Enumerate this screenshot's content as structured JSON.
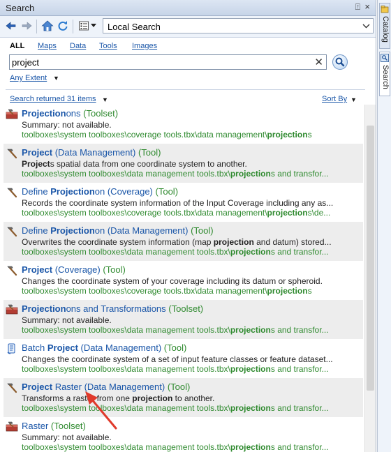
{
  "window": {
    "title": "Search",
    "pin_glyph": "⍐",
    "close_glyph": "×"
  },
  "toolbar": {
    "location": "Local Search"
  },
  "tabs": [
    "ALL",
    "Maps",
    "Data",
    "Tools",
    "Images"
  ],
  "search": {
    "value": "project"
  },
  "extent_label": "Any Extent",
  "results_count": "Search returned 31 items",
  "sort_label": "Sort By",
  "results": [
    {
      "icon": "toolset-icon",
      "name": [
        {
          "t": "Projection",
          "b": true
        },
        {
          "t": "ons",
          "b": false
        }
      ],
      "type": "(Toolset)",
      "desc": [
        {
          "t": "Summary: not available.",
          "b": false
        }
      ],
      "path": [
        {
          "t": "toolboxes\\system toolboxes\\coverage tools.tbx\\data management\\",
          "b": false
        },
        {
          "t": "projection",
          "b": true
        },
        {
          "t": "s",
          "b": false
        }
      ]
    },
    {
      "icon": "hammer-icon",
      "name": [
        {
          "t": "Project",
          "b": true
        },
        {
          "t": " (Data Management)",
          "b": false
        }
      ],
      "type": "(Tool)",
      "desc": [
        {
          "t": "Project",
          "b": true
        },
        {
          "t": "s spatial data from one coordinate system to another.",
          "b": false
        }
      ],
      "path": [
        {
          "t": "toolboxes\\system toolboxes\\data management tools.tbx\\",
          "b": false
        },
        {
          "t": "projection",
          "b": true
        },
        {
          "t": "s and transfor...",
          "b": false
        }
      ]
    },
    {
      "icon": "hammer-icon",
      "name": [
        {
          "t": "Define ",
          "b": false
        },
        {
          "t": "Projection",
          "b": true
        },
        {
          "t": "on (Coverage)",
          "b": false
        }
      ],
      "type": "(Tool)",
      "desc": [
        {
          "t": "Records the coordinate system information of the Input Coverage including any as...",
          "b": false
        }
      ],
      "path": [
        {
          "t": "toolboxes\\system toolboxes\\coverage tools.tbx\\data management\\",
          "b": false
        },
        {
          "t": "projection",
          "b": true
        },
        {
          "t": "s\\de...",
          "b": false
        }
      ]
    },
    {
      "icon": "hammer-icon",
      "name": [
        {
          "t": "Define ",
          "b": false
        },
        {
          "t": "Projection",
          "b": true
        },
        {
          "t": "on (Data Management)",
          "b": false
        }
      ],
      "type": "(Tool)",
      "desc": [
        {
          "t": "Overwrites the coordinate system information (map ",
          "b": false
        },
        {
          "t": "projection",
          "b": true
        },
        {
          "t": " and datum) stored...",
          "b": false
        }
      ],
      "path": [
        {
          "t": "toolboxes\\system toolboxes\\data management tools.tbx\\",
          "b": false
        },
        {
          "t": "projection",
          "b": true
        },
        {
          "t": "s and transfor...",
          "b": false
        }
      ]
    },
    {
      "icon": "hammer-icon",
      "name": [
        {
          "t": "Project",
          "b": true
        },
        {
          "t": " (Coverage)",
          "b": false
        }
      ],
      "type": "(Tool)",
      "desc": [
        {
          "t": "Changes the coordinate system of your coverage including its datum or spheroid.",
          "b": false
        }
      ],
      "path": [
        {
          "t": "toolboxes\\system toolboxes\\coverage tools.tbx\\data management\\",
          "b": false
        },
        {
          "t": "projection",
          "b": true
        },
        {
          "t": "s",
          "b": false
        }
      ]
    },
    {
      "icon": "toolset-icon",
      "name": [
        {
          "t": "Projection",
          "b": true
        },
        {
          "t": "ons and Transformations",
          "b": false
        }
      ],
      "type": "(Toolset)",
      "desc": [
        {
          "t": "Summary: not available.",
          "b": false
        }
      ],
      "path": [
        {
          "t": "toolboxes\\system toolboxes\\data management tools.tbx\\",
          "b": false
        },
        {
          "t": "projection",
          "b": true
        },
        {
          "t": "s and transfor...",
          "b": false
        }
      ]
    },
    {
      "icon": "script-icon",
      "name": [
        {
          "t": "Batch ",
          "b": false
        },
        {
          "t": "Project",
          "b": true
        },
        {
          "t": " (Data Management)",
          "b": false
        }
      ],
      "type": "(Tool)",
      "desc": [
        {
          "t": "Changes the coordinate system of a set of input feature classes or feature dataset...",
          "b": false
        }
      ],
      "path": [
        {
          "t": "toolboxes\\system toolboxes\\data management tools.tbx\\",
          "b": false
        },
        {
          "t": "projection",
          "b": true
        },
        {
          "t": "s and transfor...",
          "b": false
        }
      ]
    },
    {
      "icon": "hammer-icon",
      "name": [
        {
          "t": "Project",
          "b": true
        },
        {
          "t": " Raster (Data Management)",
          "b": false
        }
      ],
      "type": "(Tool)",
      "desc": [
        {
          "t": "Transforms a raster from one ",
          "b": false
        },
        {
          "t": "projection",
          "b": true
        },
        {
          "t": " to another.",
          "b": false
        }
      ],
      "path": [
        {
          "t": "toolboxes\\system toolboxes\\data management tools.tbx\\",
          "b": false
        },
        {
          "t": "projection",
          "b": true
        },
        {
          "t": "s and transfor...",
          "b": false
        }
      ]
    },
    {
      "icon": "toolset-icon",
      "name": [
        {
          "t": "Raster",
          "b": false
        }
      ],
      "type": "(Toolset)",
      "desc": [
        {
          "t": "Summary: not available.",
          "b": false
        }
      ],
      "path": [
        {
          "t": "toolboxes\\system toolboxes\\data management tools.tbx\\",
          "b": false
        },
        {
          "t": "projection",
          "b": true
        },
        {
          "t": "s and transfor...",
          "b": false
        }
      ]
    }
  ],
  "sidebar_tabs": [
    "Catalog",
    "Search"
  ],
  "colors": {
    "link": "#1a56a8",
    "type": "#2f8a2f",
    "arrow": "#e03a2b"
  }
}
